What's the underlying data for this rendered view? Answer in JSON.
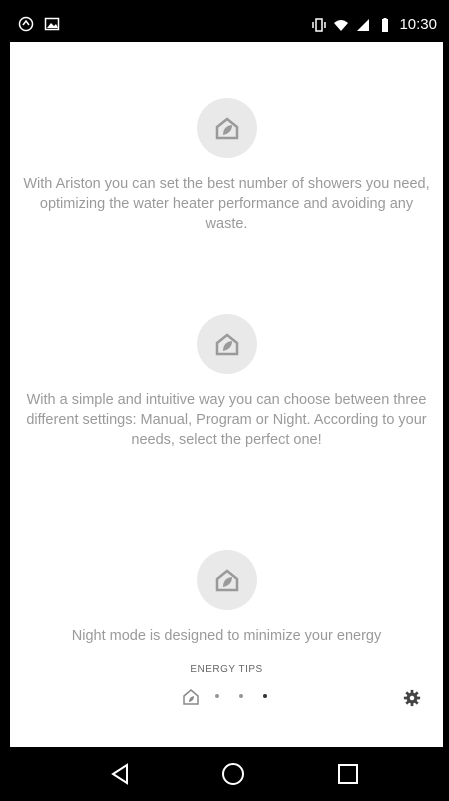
{
  "status_bar": {
    "time": "10:30",
    "icons": [
      "sync-icon",
      "image-icon",
      "vibrate-icon",
      "wifi-icon",
      "signal-icon",
      "battery-icon"
    ]
  },
  "tips": [
    {
      "icon": "home-leaf-icon",
      "text": "With Ariston you can set the best number of showers you need, optimizing the water heater performance and avoiding any waste."
    },
    {
      "icon": "home-leaf-icon",
      "text": "With a simple and intuitive way you can choose between three different settings: Manual, Program or Night. According to your needs, select the perfect one!"
    },
    {
      "icon": "home-leaf-icon",
      "text": "Night mode is designed to minimize your energy"
    }
  ],
  "footer": {
    "section_label": "ENERGY TIPS",
    "page_indicator": {
      "total": 3,
      "active": 3
    }
  },
  "navbar": {
    "buttons": [
      "back-icon",
      "home-icon",
      "recents-icon"
    ]
  },
  "colors": {
    "badge_bg": "#e9e9e9",
    "icon_stroke": "#9a9a9a",
    "text": "#9a9a9a"
  }
}
